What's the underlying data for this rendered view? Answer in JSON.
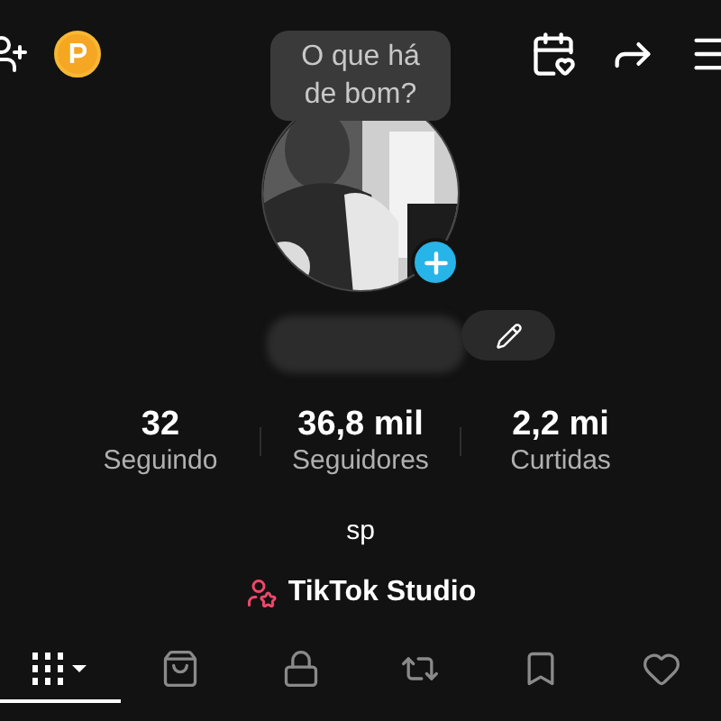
{
  "tooltip": {
    "text": "O que há de bom?"
  },
  "stats": [
    {
      "value": "32",
      "label": "Seguindo"
    },
    {
      "value": "36,8 mil",
      "label": "Seguidores"
    },
    {
      "value": "2,2 mi",
      "label": "Curtidas"
    }
  ],
  "bio": "sp",
  "studio_link": {
    "label": "TikTok Studio"
  },
  "tabs": [
    {
      "kind": "grid",
      "selected": true
    },
    {
      "kind": "bag",
      "selected": false
    },
    {
      "kind": "lock",
      "selected": false
    },
    {
      "kind": "repost",
      "selected": false
    },
    {
      "kind": "bookmark",
      "selected": false
    },
    {
      "kind": "heart",
      "selected": false
    }
  ]
}
